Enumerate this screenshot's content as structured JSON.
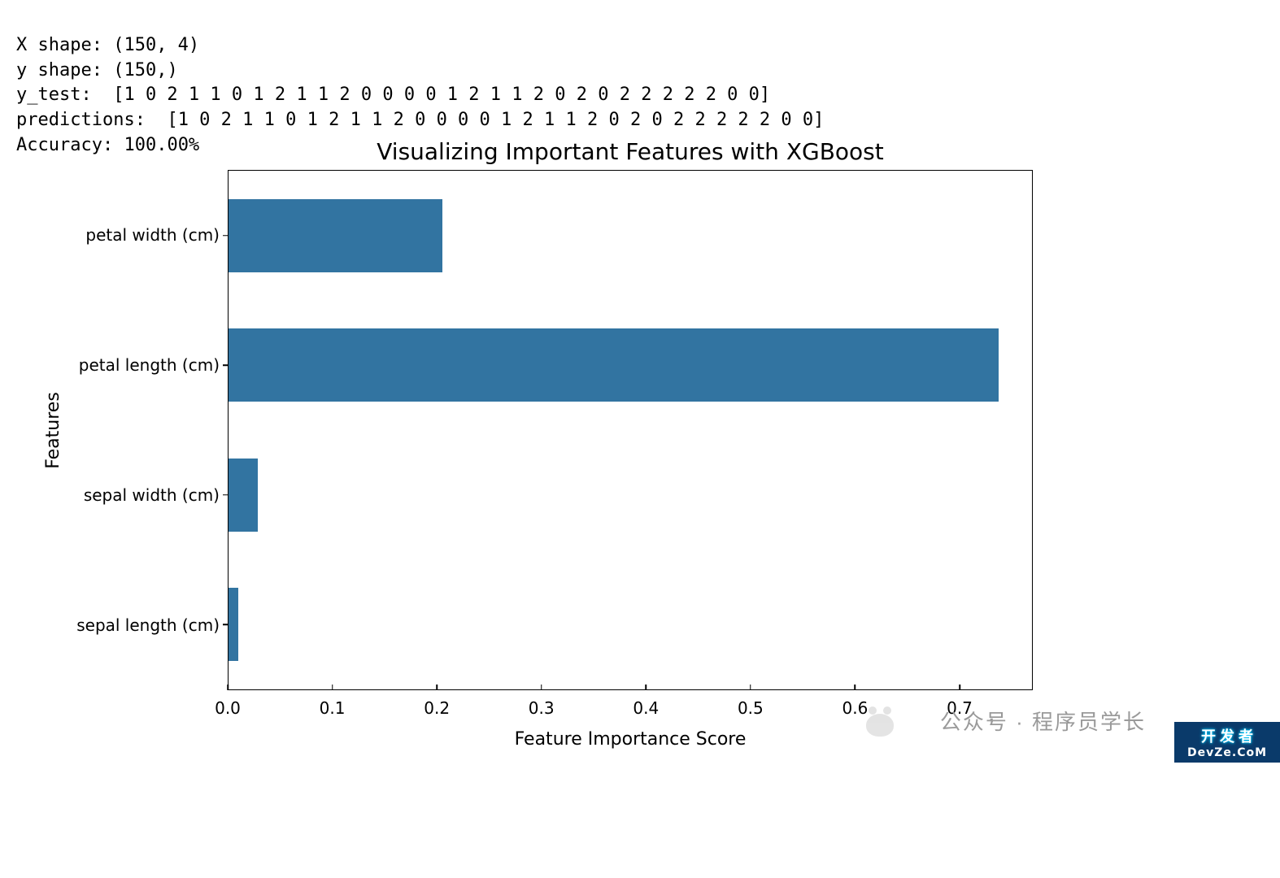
{
  "console": {
    "line1_label": "X shape:",
    "line1_value": " (150, 4)",
    "line2_label": "y shape:",
    "line2_value": " (150,)",
    "line3_label": "y_test:",
    "line3_value": "  [1 0 2 1 1 0 1 2 1 1 2 0 0 0 0 1 2 1 1 2 0 2 0 2 2 2 2 2 0 0]",
    "line4_label": "predictions:",
    "line4_value": "  [1 0 2 1 1 0 1 2 1 1 2 0 0 0 0 1 2 1 1 2 0 2 0 2 2 2 2 2 0 0]",
    "line5_label": "Accuracy:",
    "line5_value": " 100.00%"
  },
  "chart_data": {
    "type": "bar",
    "orientation": "horizontal",
    "title": "Visualizing Important Features with XGBoost",
    "xlabel": "Feature Importance Score",
    "ylabel": "Features",
    "categories": [
      "petal width (cm)",
      "petal length (cm)",
      "sepal width (cm)",
      "sepal length (cm)"
    ],
    "values": [
      0.205,
      0.738,
      0.028,
      0.009
    ],
    "xlim": [
      0.0,
      0.77
    ],
    "xticks": [
      0.0,
      0.1,
      0.2,
      0.3,
      0.4,
      0.5,
      0.6,
      0.7
    ],
    "xtick_labels": [
      "0.0",
      "0.1",
      "0.2",
      "0.3",
      "0.4",
      "0.5",
      "0.6",
      "0.7"
    ],
    "bar_color": "#3274a1"
  },
  "watermark": {
    "text": "公众号 · 程序员学长",
    "logo": "wechat-icon"
  },
  "corner_badge": {
    "line1": "开 发 者",
    "line2": "DevZe.CoM"
  }
}
